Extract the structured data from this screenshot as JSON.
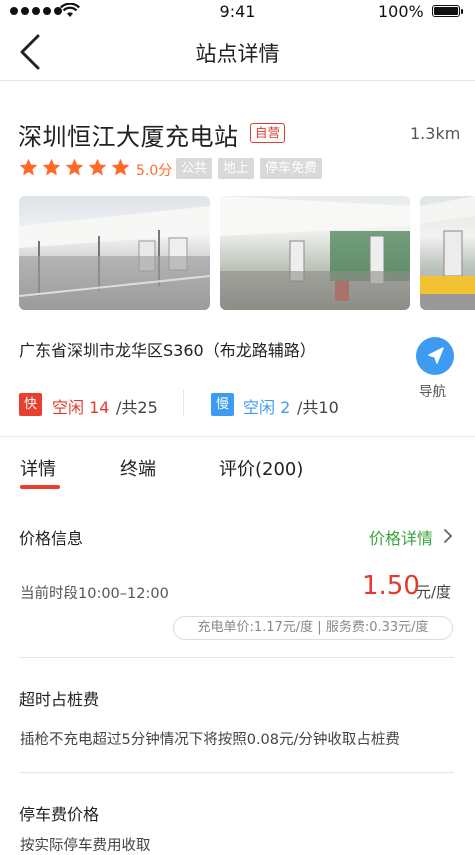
{
  "status_bar": {
    "time": "9:41",
    "battery": "100%",
    "signal_bars": 5
  },
  "nav": {
    "title": "站点详情",
    "back_icon": "chevron-left-icon"
  },
  "station": {
    "name": "深圳恒江大厦充电站",
    "self_operated_tag": "自营",
    "distance": "1.3km",
    "stars": 5,
    "rating_text": "5.0分",
    "tags": [
      "公共",
      "地上",
      "停车免费"
    ],
    "address": "广东省深圳市龙华区S360（布龙路辅路）",
    "navigate_label": "导航",
    "photos": 3
  },
  "chargers": {
    "fast": {
      "badge": "快",
      "idle_label": "空闲 14",
      "total_label": "/共25"
    },
    "slow": {
      "badge": "慢",
      "idle_label": "空闲 2",
      "total_label": "/共10"
    }
  },
  "tabs": [
    {
      "label": "详情",
      "active": true
    },
    {
      "label": "终端",
      "active": false
    },
    {
      "label": "评价(200)",
      "active": false
    }
  ],
  "price": {
    "title": "价格信息",
    "detail_link": "价格详情",
    "period": "当前时段10:00–12:00",
    "value": "1.50",
    "unit": "元/度",
    "breakdown": "充电单价:1.17元/度 | 服务费:0.33元/度"
  },
  "overtime": {
    "title": "超时占桩费",
    "text": "插枪不充电超过5分钟情况下将按照0.08元/分钟收取占桩费"
  },
  "parking": {
    "title": "停车费价格",
    "text": "按实际停车费用收取"
  },
  "colors": {
    "accent_red": "#e23b2e",
    "accent_blue": "#3d9bf1",
    "accent_green": "#3aa53a",
    "star": "#ff6a2a"
  }
}
